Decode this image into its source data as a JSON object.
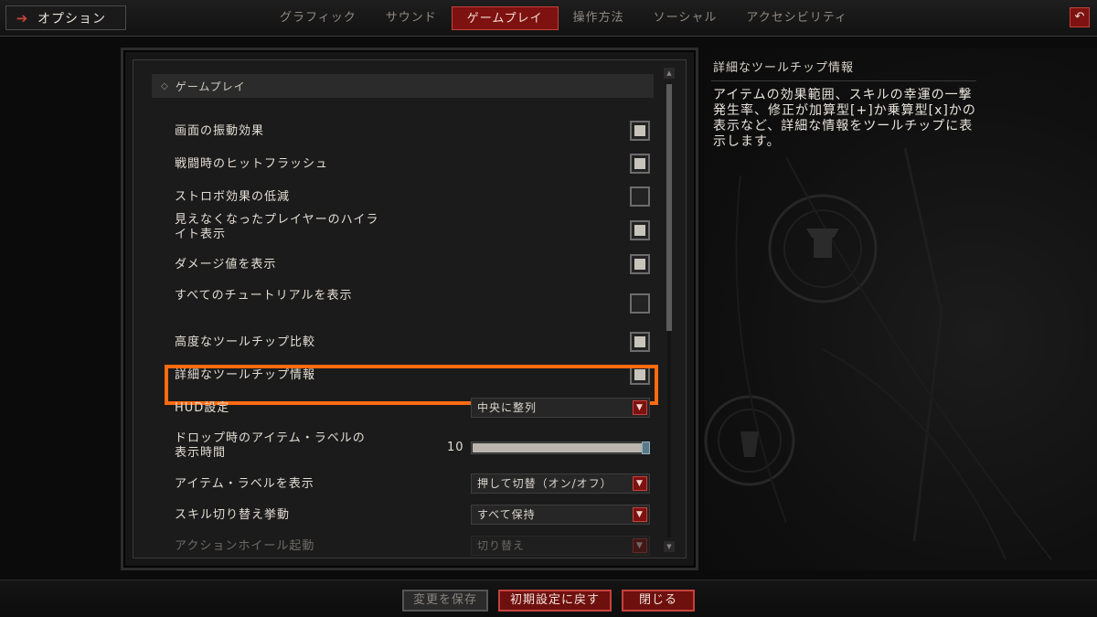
{
  "window": {
    "title": "オプション",
    "back_icon": "back-arrow-icon"
  },
  "tabs": [
    {
      "label": "グラフィック",
      "active": false
    },
    {
      "label": "サウンド",
      "active": false
    },
    {
      "label": "ゲームプレイ",
      "active": true
    },
    {
      "label": "操作方法",
      "active": false
    },
    {
      "label": "ソーシャル",
      "active": false
    },
    {
      "label": "アクセシビリティ",
      "active": false
    }
  ],
  "section": {
    "header": "ゲームプレイ"
  },
  "settings": [
    {
      "label": "画面の振動効果",
      "type": "checkbox",
      "checked": true
    },
    {
      "label": "戦闘時のヒットフラッシュ",
      "type": "checkbox",
      "checked": true
    },
    {
      "label": "ストロボ効果の低減",
      "type": "checkbox",
      "checked": false
    },
    {
      "label": "見えなくなったプレイヤーのハイライト表示",
      "type": "checkbox",
      "checked": true
    },
    {
      "label": "ダメージ値を表示",
      "type": "checkbox",
      "checked": true
    },
    {
      "label": "すべてのチュートリアルを表示",
      "type": "checkbox",
      "checked": false
    },
    {
      "label": "高度なツールチップ比較",
      "type": "checkbox",
      "checked": true
    },
    {
      "label": "詳細なツールチップ情報",
      "type": "checkbox",
      "checked": true,
      "highlighted": true
    },
    {
      "label": "HUD設定",
      "type": "dropdown",
      "value": "中央に整列"
    },
    {
      "label": "ドロップ時のアイテム・ラベルの表示時間",
      "type": "slider",
      "value": "10",
      "fill_fraction": 1.0
    },
    {
      "label": "アイテム・ラベルを表示",
      "type": "dropdown",
      "value": "押して切替（オン/オフ）"
    },
    {
      "label": "スキル切り替え挙動",
      "type": "dropdown",
      "value": "すべて保持"
    },
    {
      "label": "アクションホイール起動",
      "type": "dropdown",
      "value": "切り替え",
      "faded": true
    }
  ],
  "description": {
    "title": "詳細なツールチップ情報",
    "body": "アイテムの効果範囲、スキルの幸運の一撃発生率、修正が加算型[+]か乗算型[x]かの表示など、詳細な情報をツールチップに表示します。"
  },
  "buttons": {
    "save": "変更を保存",
    "reset": "初期設定に戻す",
    "close": "閉じる"
  },
  "colors": {
    "accent_red": "#7d1210",
    "highlight_orange": "#ff6b10"
  }
}
